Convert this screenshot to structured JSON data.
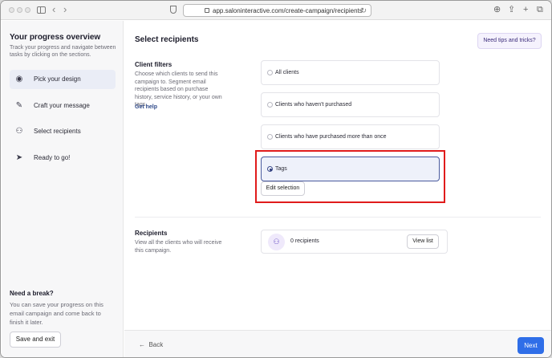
{
  "browser": {
    "url": "app.saloninteractive.com/create-campaign/recipients",
    "icons": [
      "close-dot",
      "minimize-dot",
      "zoom-dot",
      "sidebar-toggle-icon",
      "back-arrow-icon",
      "forward-arrow-icon",
      "shield-icon",
      "lock-icon",
      "reload-icon",
      "download-icon",
      "share-icon",
      "new-tab-icon",
      "tab-overview-icon"
    ]
  },
  "sidebar": {
    "title": "Your progress overview",
    "subtitle": "Track your progress and navigate between tasks by clicking on the sections.",
    "steps": [
      {
        "label": "Pick your design",
        "icon": "palette-icon",
        "active": true
      },
      {
        "label": "Craft your message",
        "icon": "pencil-icon",
        "active": false
      },
      {
        "label": "Select recipients",
        "icon": "users-icon",
        "active": false
      },
      {
        "label": "Ready to go!",
        "icon": "send-icon",
        "active": false
      }
    ],
    "break_title": "Need a break?",
    "break_text": "You can save your progress on this email campaign and come back to finish it later.",
    "save_exit_label": "Save and exit"
  },
  "main": {
    "title": "Select recipients",
    "tips_label": "Need tips and tricks?",
    "client_filters": {
      "title": "Client filters",
      "description": "Choose which clients to send this campaign to. Segment email recipients based on purchase history, service history, or your own tags.",
      "help_link": "Get help",
      "options": [
        {
          "label": "All clients",
          "selected": false
        },
        {
          "label": "Clients who haven't purchased",
          "selected": false
        },
        {
          "label": "Clients who have purchased more than once",
          "selected": false
        },
        {
          "label": "Tags",
          "selected": true
        }
      ],
      "edit_selection_label": "Edit selection"
    },
    "recipients": {
      "title": "Recipients",
      "description": "View all the clients who will receive this campaign.",
      "count_text": "0 recipients",
      "view_list_label": "View list"
    },
    "footer": {
      "back_label": "Back",
      "next_label": "Next"
    }
  },
  "colors": {
    "accent": "#2f6ee8",
    "highlight": "#e01b1b",
    "selected_border": "#4a5b9e"
  }
}
